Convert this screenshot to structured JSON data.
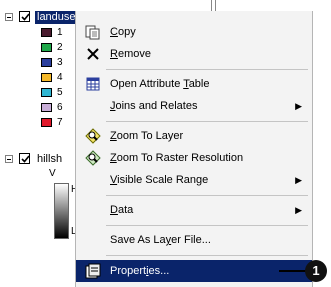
{
  "toc": {
    "layer1": {
      "name": "landuse",
      "checked": true,
      "expanded": true
    },
    "legend": [
      {
        "label": "1",
        "color": "#4a1a2e"
      },
      {
        "label": "2",
        "color": "#1fa84a"
      },
      {
        "label": "3",
        "color": "#2b3f9e"
      },
      {
        "label": "4",
        "color": "#f5b92a"
      },
      {
        "label": "5",
        "color": "#2fb6d2"
      },
      {
        "label": "6",
        "color": "#c9aed8"
      },
      {
        "label": "7",
        "color": "#e0182b"
      }
    ],
    "layer2": {
      "name": "hillsh",
      "checked": true,
      "expanded": true
    },
    "layer2_sub": "V",
    "ramp_high": "Hi",
    "ramp_low": "Lo"
  },
  "menu": {
    "copy": {
      "pre": "",
      "u": "C",
      "post": "opy"
    },
    "remove": {
      "pre": "",
      "u": "R",
      "post": "emove"
    },
    "open_attribute_table": {
      "pre": "Open Attribute ",
      "u": "T",
      "post": "able"
    },
    "joins_and_relates": {
      "pre": "",
      "u": "J",
      "post": "oins and Relates"
    },
    "zoom_to_layer": {
      "pre": "",
      "u": "Z",
      "post": "oom To Layer"
    },
    "zoom_to_raster_resolution": {
      "pre": "",
      "u": "Z",
      "post": "oom To Raster Resolution"
    },
    "visible_scale_range": {
      "pre": "",
      "u": "V",
      "post": "isible Scale Range"
    },
    "data": {
      "pre": "",
      "u": "D",
      "post": "ata"
    },
    "save_as_layer_file": {
      "pre": "Save As La",
      "u": "y",
      "post": "er File..."
    },
    "properties": {
      "pre": "Propert",
      "u": "i",
      "post": "es..."
    }
  },
  "callout": {
    "number": "1"
  },
  "icons": {
    "copy": "copy-icon",
    "remove": "remove-x-icon",
    "attribute_table": "table-icon",
    "zoom_layer": "zoom-to-layer-icon",
    "zoom_raster": "zoom-raster-icon",
    "properties": "properties-icon",
    "submenu": "submenu-arrow-icon"
  },
  "colors": {
    "highlight": "#0a246a",
    "menu_bg": "#f3f3f3"
  }
}
